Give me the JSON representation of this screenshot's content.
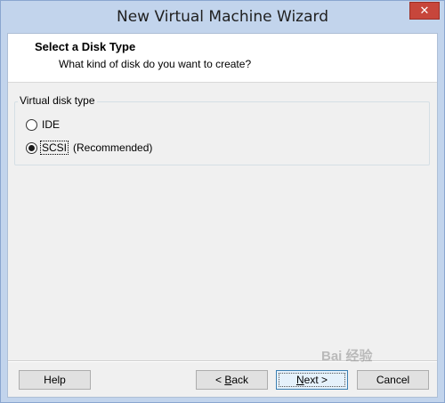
{
  "window": {
    "title": "New Virtual Machine Wizard",
    "close_label": "✕"
  },
  "header": {
    "title": "Select a Disk Type",
    "subtitle": "What kind of disk do you want to create?"
  },
  "disk_type": {
    "group_label": "Virtual disk type",
    "options": [
      {
        "label": "IDE",
        "checked": false
      },
      {
        "label": "SCSI",
        "checked": true,
        "note": "(Recommended)"
      }
    ]
  },
  "buttons": {
    "help": "Help",
    "back_prefix": "< ",
    "back_ul": "B",
    "back_rest": "ack",
    "next_ul": "N",
    "next_rest": "ext >",
    "cancel": "Cancel"
  },
  "watermark": "Bai 经验"
}
